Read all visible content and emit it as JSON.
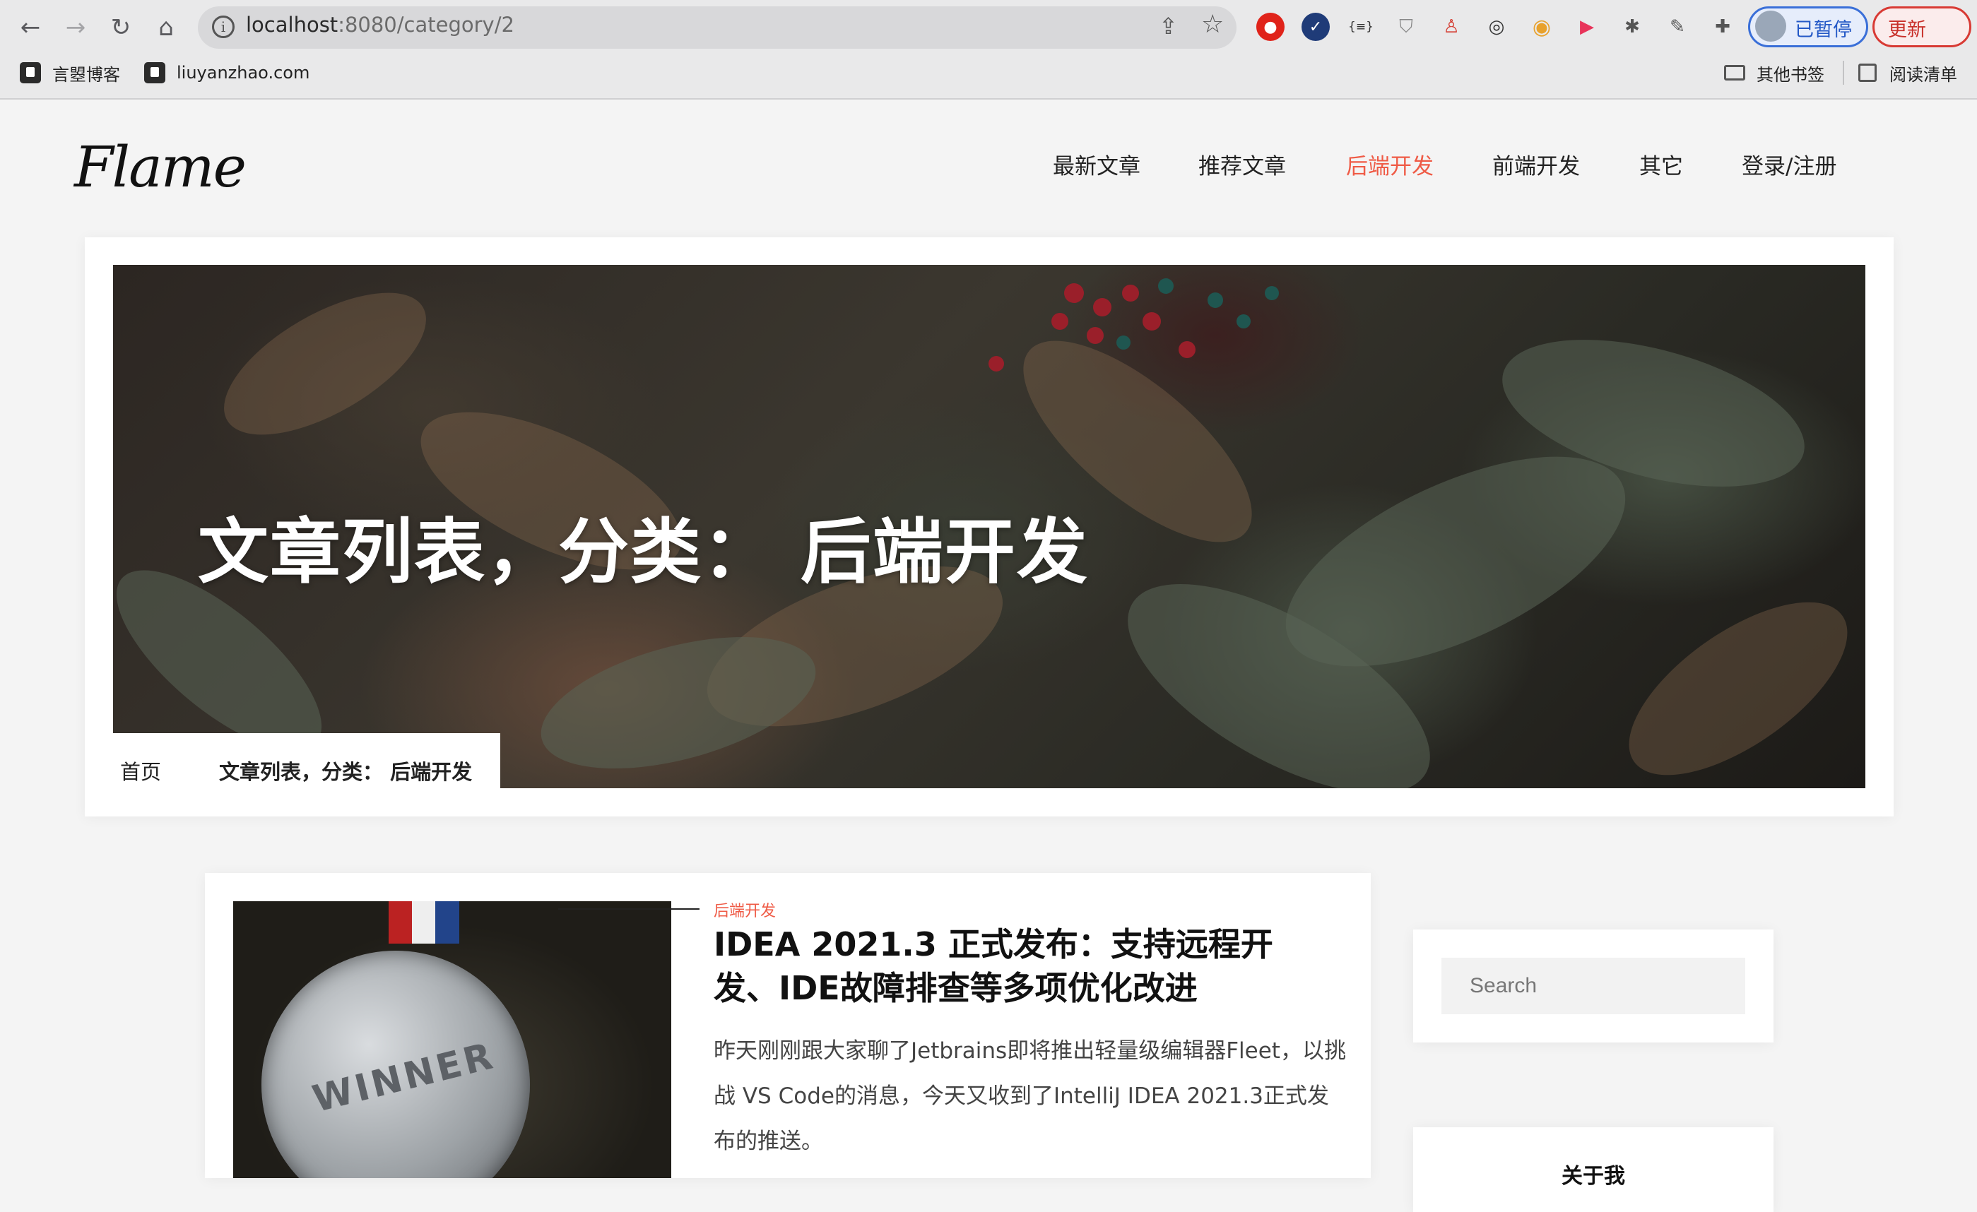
{
  "browser": {
    "url_host": "localhost",
    "url_rest": ":8080/category/2",
    "profile_label": "已暂停",
    "update_label": "更新",
    "bookmarks": [
      {
        "label": "言曌博客"
      },
      {
        "label": "liuyanzhao.com"
      }
    ],
    "other_bookmarks": "其他书签",
    "reading_list": "阅读清单",
    "extension_label": "{≡}"
  },
  "site": {
    "logo": "Flame",
    "nav": [
      "最新文章",
      "推荐文章",
      "后端开发",
      "前端开发",
      "其它",
      "登录/注册"
    ],
    "active_nav": "后端开发",
    "accent_color": "#ef5b46"
  },
  "hero": {
    "title": "文章列表，分类：  后端开发",
    "breadcrumb_home": "首页",
    "breadcrumb_current": "文章列表，分类：  后端开发"
  },
  "post": {
    "category": "后端开发",
    "title": "IDEA 2021.3 正式发布：支持远程开发、IDE故障排查等多项优化改进",
    "excerpt": "昨天刚刚跟大家聊了Jetbrains即将推出轻量级编辑器Fleet，以挑战 VS Code的消息，今天又收到了IntelliJ IDEA 2021.3正式发布的推送。",
    "image_text": "WINNER"
  },
  "sidebar": {
    "search_placeholder": "Search",
    "about_title": "关于我"
  }
}
